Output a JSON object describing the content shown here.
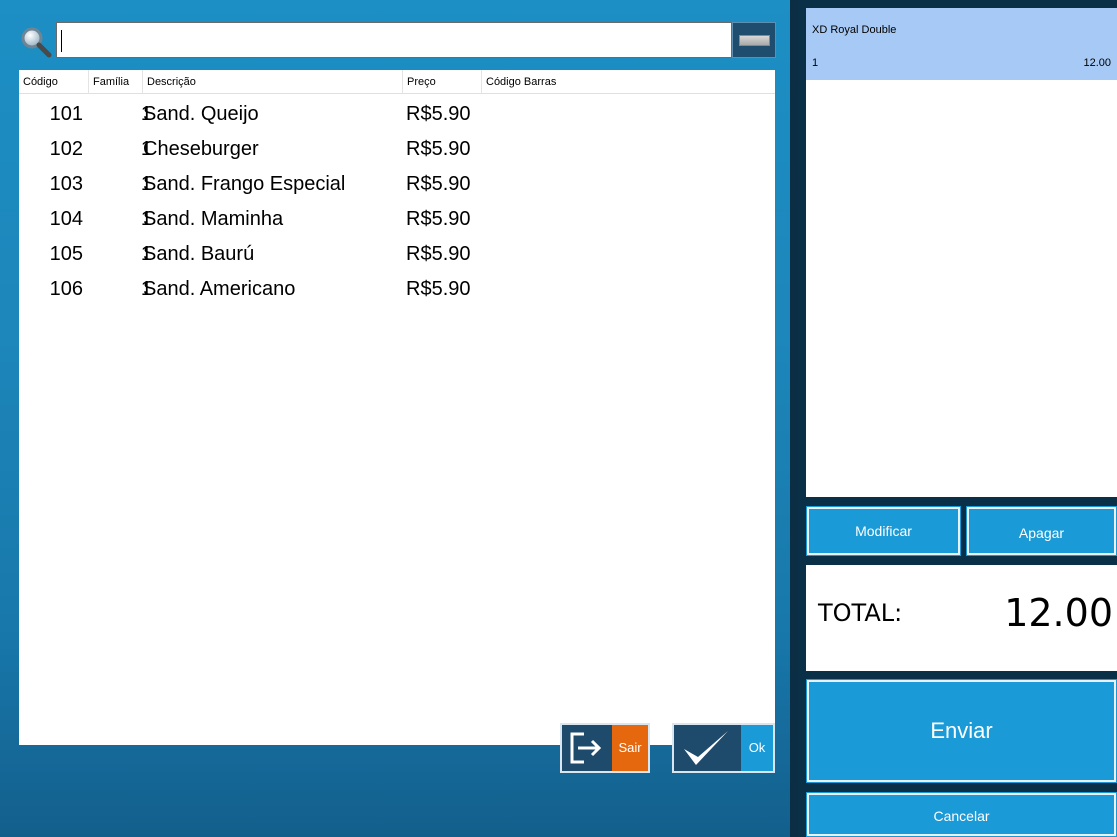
{
  "search": {
    "value": ""
  },
  "table": {
    "headers": {
      "code": "Código",
      "family": "Família",
      "description": "Descrição",
      "price": "Preço",
      "barcode": "Código Barras"
    },
    "rows": [
      {
        "code": "101",
        "family": "1",
        "description": "Sand. Queijo",
        "price": "R$5.90"
      },
      {
        "code": "102",
        "family": "1",
        "description": "Cheseburger",
        "price": "R$5.90"
      },
      {
        "code": "103",
        "family": "1",
        "description": "Sand. Frango Especial",
        "price": "R$5.90"
      },
      {
        "code": "104",
        "family": "1",
        "description": "Sand. Maminha",
        "price": "R$5.90"
      },
      {
        "code": "105",
        "family": "1",
        "description": "Sand. Baurú",
        "price": "R$5.90"
      },
      {
        "code": "106",
        "family": "1",
        "description": "Sand. Americano",
        "price": "R$5.90"
      }
    ]
  },
  "actions": {
    "exit_label": "Sair",
    "ok_label": "Ok"
  },
  "order": {
    "items": [
      {
        "name": "XD Royal Double",
        "qty": "1",
        "price": "12.00"
      }
    ],
    "modify_label": "Modificar",
    "delete_label": "Apagar",
    "total_label": "TOTAL:",
    "total_value": "12.00",
    "send_label": "Enviar",
    "cancel_label": "Cancelar"
  },
  "icons": {
    "search": "magnifier-icon",
    "keyboard": "keyboard-icon",
    "exit": "exit-icon",
    "ok": "checkmark-icon"
  },
  "colors": {
    "accent": "#1a9ad6",
    "exit_accent": "#e5670e",
    "selected_row": "#a7c9f5",
    "dark_button": "#1e4a6c"
  }
}
